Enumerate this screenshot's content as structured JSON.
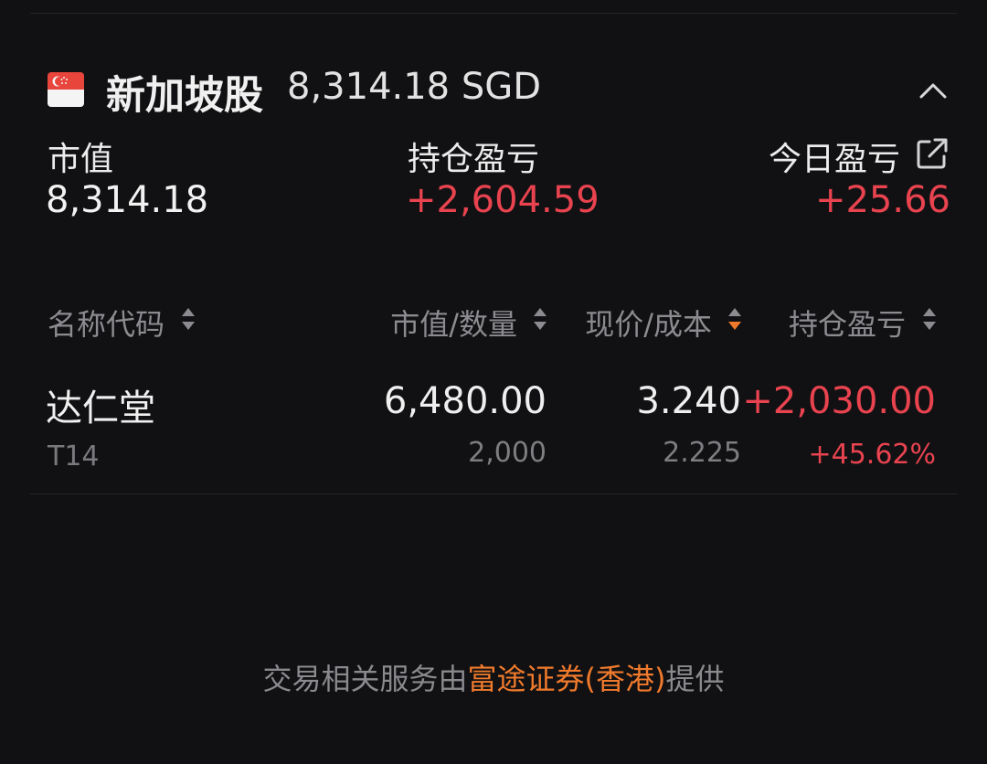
{
  "header": {
    "market_name": "新加坡股",
    "market_total": "8,314.18 SGD",
    "flag_icon": "singapore-flag-icon",
    "collapse_icon": "chevron-up-icon"
  },
  "summary": {
    "market_value_label": "市值",
    "market_value": "8,314.18",
    "position_pl_label": "持仓盈亏",
    "position_pl": "+2,604.59",
    "today_pl_label": "今日盈亏",
    "today_pl": "+25.66",
    "share_icon": "share-icon"
  },
  "table": {
    "columns": [
      "名称代码",
      "市值/数量",
      "现价/成本",
      "持仓盈亏"
    ],
    "rows": [
      {
        "name": "达仁堂",
        "code": "T14",
        "market_value": "6,480.00",
        "quantity": "2,000",
        "price": "3.240",
        "cost": "2.225",
        "pl": "+2,030.00",
        "pl_pct": "+45.62%"
      }
    ]
  },
  "footer": {
    "prefix": "交易相关服务由",
    "provider": "富途证券(香港)",
    "suffix": "提供"
  },
  "colors": {
    "background": "#111113",
    "gain_red": "#e8434f",
    "accent_orange": "#f07a2c",
    "muted": "#8c8c90"
  }
}
